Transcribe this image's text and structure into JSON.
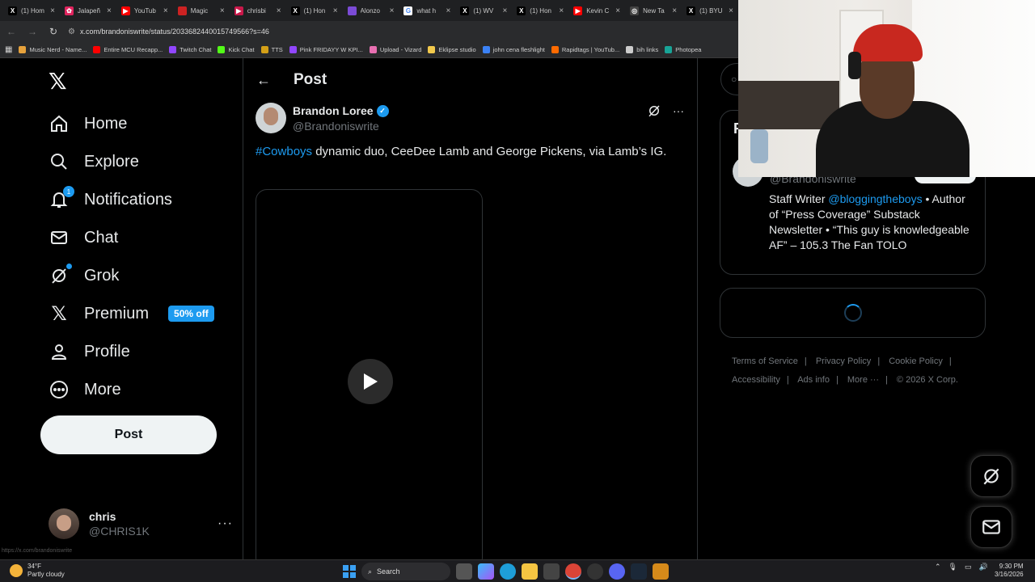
{
  "browser": {
    "tabs": [
      {
        "label": "(1) Hom",
        "color": "#000000",
        "glyph": "X"
      },
      {
        "label": "Jalapeñ",
        "color": "#e0245e",
        "glyph": "✿"
      },
      {
        "label": "YouTub",
        "color": "#ff0000",
        "glyph": "▶"
      },
      {
        "label": "Magic",
        "color": "#cc2222",
        "glyph": ""
      },
      {
        "label": "chrisbi",
        "color": "#c9184a",
        "glyph": "▶"
      },
      {
        "label": "(1) Hon",
        "color": "#000000",
        "glyph": "X"
      },
      {
        "label": "Alonzo",
        "color": "#7b4bd6",
        "glyph": ""
      },
      {
        "label": "what h",
        "color": "#ffffff",
        "glyph": "G"
      },
      {
        "label": "(1) WV",
        "color": "#000000",
        "glyph": "X"
      },
      {
        "label": "(1) Hon",
        "color": "#000000",
        "glyph": "X"
      },
      {
        "label": "Kevin C",
        "color": "#ff0000",
        "glyph": "▶"
      },
      {
        "label": "New Ta",
        "color": "#444444",
        "glyph": "◎"
      },
      {
        "label": "(1) BYU",
        "color": "#000000",
        "glyph": "X"
      }
    ],
    "url": "x.com/brandoniswrite/status/2033682440015749566?s=46",
    "bookmarks": [
      {
        "label": "Music Nerd - Name...",
        "color": "#e6a23c"
      },
      {
        "label": "Entire MCU Recapp...",
        "color": "#ff0000"
      },
      {
        "label": "Twitch Chat",
        "color": "#9146ff"
      },
      {
        "label": "Kick Chat",
        "color": "#53fc18"
      },
      {
        "label": "TTS",
        "color": "#d4a017"
      },
      {
        "label": "Pink FRIDAYY W KPI...",
        "color": "#9146ff"
      },
      {
        "label": "Upload - Vizard",
        "color": "#e86fb1"
      },
      {
        "label": "Eklipse studio",
        "color": "#f2c94c"
      },
      {
        "label": "john cena fleshlight",
        "color": "#3b82f6"
      },
      {
        "label": "Rapidtags | YouTub...",
        "color": "#ff6b00"
      },
      {
        "label": "bih links",
        "color": "#cccccc"
      },
      {
        "label": "Photopea",
        "color": "#18a497"
      }
    ]
  },
  "nav": {
    "items": [
      {
        "label": "Home",
        "icon": "home-icon"
      },
      {
        "label": "Explore",
        "icon": "search-icon"
      },
      {
        "label": "Notifications",
        "icon": "bell-icon",
        "badge": "1"
      },
      {
        "label": "Chat",
        "icon": "mail-icon"
      },
      {
        "label": "Grok",
        "icon": "grok-icon"
      },
      {
        "label": "Premium",
        "icon": "x-premium-icon",
        "badge": "50% off"
      },
      {
        "label": "Profile",
        "icon": "person-icon"
      },
      {
        "label": "More",
        "icon": "more-circle-icon"
      }
    ],
    "post_button": "Post",
    "account": {
      "name": "chris",
      "handle": "@CHRIS1K"
    },
    "status_link": "https://x.com/brandoniswrite"
  },
  "post": {
    "header_title": "Post",
    "author_name": "Brandon Loree",
    "author_handle": "@Brandoniswrite",
    "hashtag": "#Cowboys",
    "text": " dynamic duo, CeeDee Lamb and George Pickens, via Lamb’s IG."
  },
  "sidebar": {
    "card_letter": "R",
    "bio_handle": "@Brandoniswrite",
    "bio_prefix": "Staff Writer ",
    "bio_mention": "@bloggingtheboys",
    "bio_rest": " • Author of “Press Coverage” Substack Newsletter • “This guy is knowledgeable AF” – 105.3 The Fan TOLO",
    "footer": {
      "terms": "Terms of Service",
      "privacy": "Privacy Policy",
      "cookie": "Cookie Policy",
      "accessibility": "Accessibility",
      "ads": "Ads info",
      "more": "More ···",
      "copyright": "© 2026 X Corp."
    }
  },
  "taskbar": {
    "temp": "34°F",
    "weather": "Partly cloudy",
    "search": "Search",
    "time": "9:30 PM",
    "date": "3/16/2026"
  },
  "colors": {
    "accent": "#1d9bf0",
    "background": "#000000",
    "border": "#2f3336"
  }
}
